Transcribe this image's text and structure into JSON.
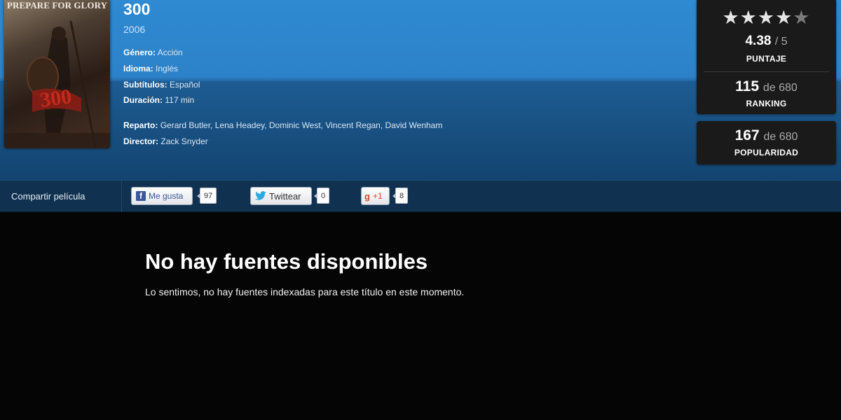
{
  "movie": {
    "poster": {
      "alt": "300 poster",
      "caption_top": "PREPARE FOR GLORY",
      "caption_title": "300"
    },
    "title": "300",
    "year": "2006",
    "details": [
      {
        "key": "Género:",
        "value": "Acción"
      },
      {
        "key": "Idioma:",
        "value": "Inglés"
      },
      {
        "key": "Subtítulos:",
        "value": "Español"
      },
      {
        "key": "Duración:",
        "value": "117 min"
      }
    ],
    "credits": [
      {
        "key": "Reparto:",
        "value": "Gerard Butler, Lena Headey, Dominic West, Vincent Regan, David Wenham"
      },
      {
        "key": "Director:",
        "value": "Zack Snyder"
      }
    ]
  },
  "rating": {
    "stars": 4.38,
    "score": "4.38",
    "score_of": "/ 5",
    "score_label": "PUNTAJE",
    "ranking": "115",
    "ranking_of": "de 680",
    "ranking_label": "RANKING",
    "popularity": "167",
    "popularity_of": "de 680",
    "popularity_label": "POPULARIDAD"
  },
  "share": {
    "label": "Compartir película",
    "facebook": {
      "icon": "facebook-icon",
      "label": "Me gusta",
      "count": "97"
    },
    "twitter": {
      "icon": "twitter-bird-icon",
      "label": "Twittear",
      "count": "0"
    },
    "gplus": {
      "icon": "google-plus-icon",
      "label": "+1",
      "count": "8"
    }
  },
  "notice": {
    "title": "No hay fuentes disponibles",
    "text": "Lo sentimos, no hay fuentes indexadas para este título en este momento."
  },
  "colors": {
    "hero_top": "#2f8ad2",
    "hero_bottom": "#123f66",
    "share_bar": "#10314f",
    "panel": "#1a1a1a",
    "page_bg": "#050505"
  }
}
